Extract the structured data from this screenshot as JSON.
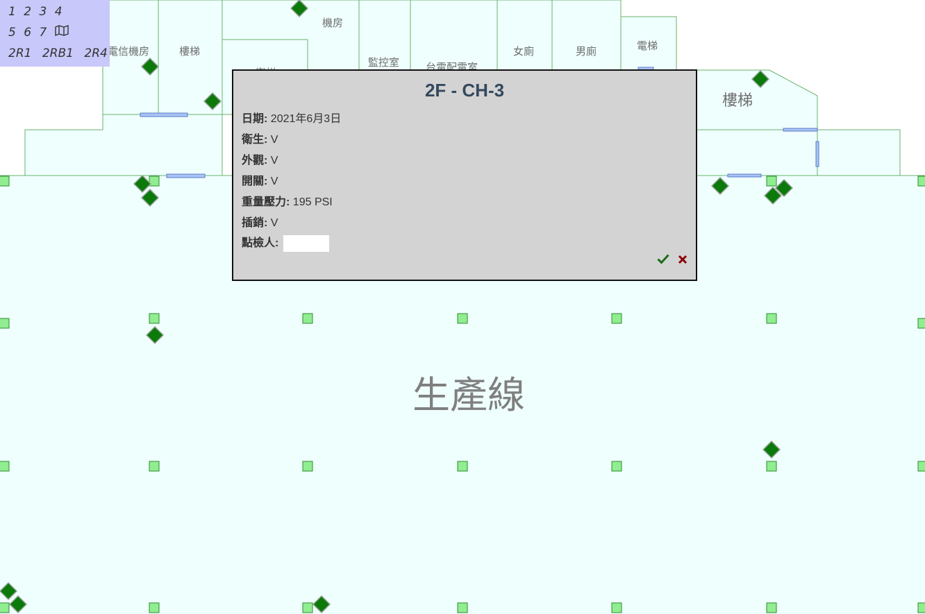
{
  "floor_nav": {
    "row1": [
      "1",
      "2",
      "3",
      "4"
    ],
    "row2": [
      "5",
      "6",
      "7"
    ],
    "map_icon": "map-icon",
    "row3": [
      "2R1",
      "2RB1",
      "2R4"
    ]
  },
  "rooms": {
    "telecom": "電信機房",
    "stairs_left": "樓梯",
    "machine_room": "機房",
    "hidden_room": "衛梯",
    "monitoring": "監控室",
    "power_room": "台電配電室",
    "womens_restroom": "女廁",
    "mens_restroom": "男廁",
    "elevator": "電梯",
    "stairs_right": "樓梯",
    "production_line": "生產線"
  },
  "popup": {
    "title": "2F - CH-3",
    "date_label": "日期:",
    "date_value": "2021年6月3日",
    "hygiene_label": "衛生:",
    "hygiene_value": "V",
    "appearance_label": "外觀:",
    "appearance_value": "V",
    "switch_label": "開關:",
    "switch_value": "V",
    "pressure_label": "重量壓力:",
    "pressure_value": "195 PSI",
    "pin_label": "插銷:",
    "pin_value": "V",
    "inspector_label": "點檢人:",
    "inspector_value": "",
    "confirm_icon": "check-icon",
    "cancel_icon": "close-icon"
  },
  "colors": {
    "floor_fill": "#effffd",
    "wall_stroke": "#6ab06a",
    "marker_square": "#90ee90",
    "marker_diamond": "#0b7a0b",
    "door": "#a9c4f5",
    "nav_bg": "#c8c8fa",
    "popup_bg": "#d3d3d3",
    "title_color": "#34495e",
    "confirm_color": "#1a6b1a",
    "cancel_color": "#8b0000"
  }
}
